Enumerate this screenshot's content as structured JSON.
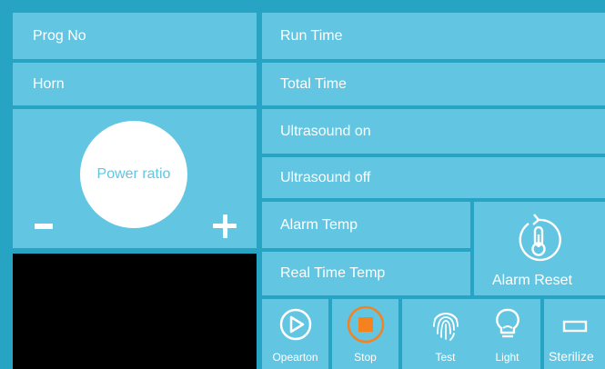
{
  "left_rows": {
    "prog_no": "Prog No",
    "horn": "Horn"
  },
  "right_rows": {
    "run_time": "Run Time",
    "total_time": "Total Time",
    "ultrasound_on": "Ultrasound on",
    "ultrasound_off": "Ultrasound off",
    "alarm_temp": "Alarm Temp",
    "real_time_temp": "Real Time Temp"
  },
  "power": {
    "label": "Power ratio",
    "minus_icon": "minus-icon",
    "plus_icon": "plus-icon"
  },
  "alarm_reset": {
    "label": "Alarm Reset",
    "icon": "thermometer-reset-icon"
  },
  "toolbar": [
    {
      "label": "Opearton",
      "icon": "play-circle-icon"
    },
    {
      "label": "Stop",
      "icon": "stop-icon"
    },
    {
      "label": "Test",
      "icon": "fingerprint-icon"
    },
    {
      "label": "Light",
      "icon": "lightbulb-icon"
    },
    {
      "label": "Sterilize",
      "icon": "rectangle-icon"
    }
  ],
  "colors": {
    "border": "#27a3c3",
    "cell": "#62c5e2",
    "text": "#ffffff",
    "stop_accent": "#f5821f",
    "display": "#000000"
  }
}
